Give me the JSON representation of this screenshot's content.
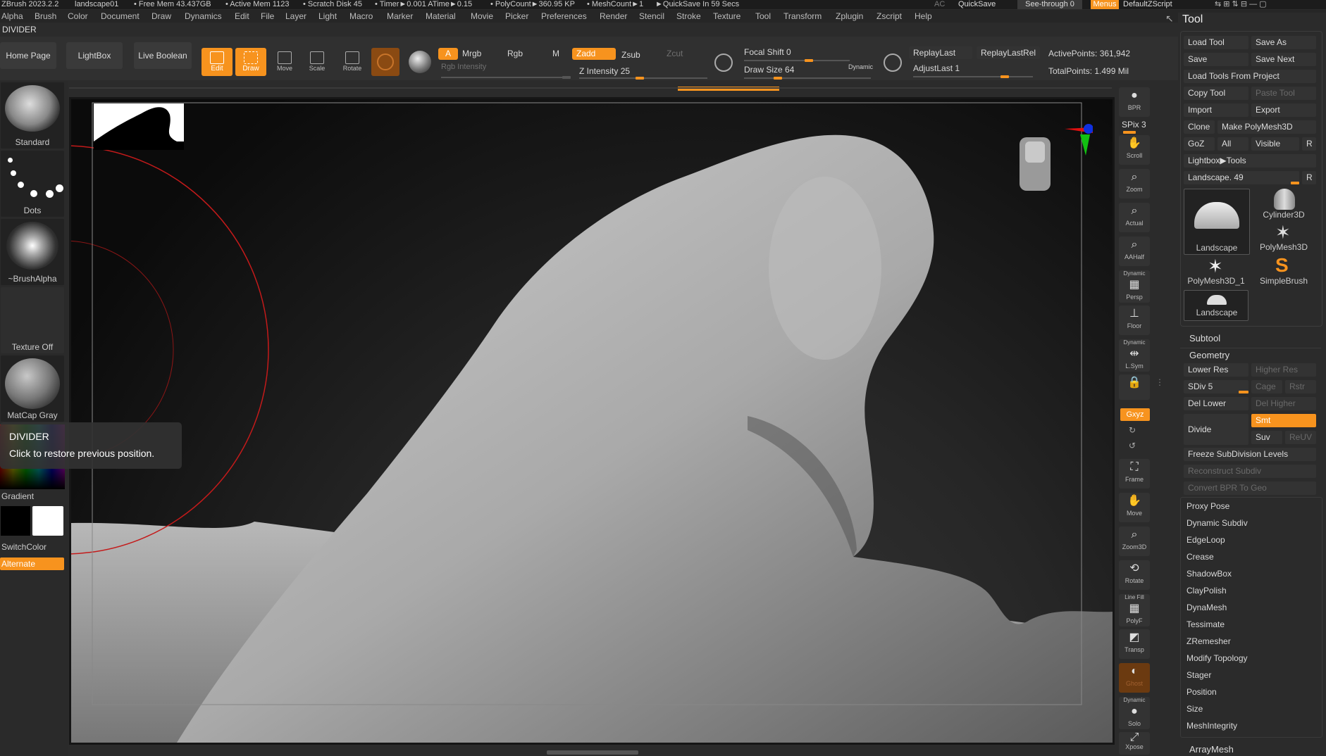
{
  "titlebar": {
    "app": "ZBrush 2023.2.2",
    "document": "landscape01",
    "free_mem": "• Free Mem 43.437GB",
    "active_mem": "• Active Mem 1123",
    "scratch": "• Scratch Disk 45",
    "timer": "• Timer►0.001 ATime►0.15",
    "polycount": "• PolyCount►360.95 KP",
    "meshcount": "• MeshCount►1",
    "quicksave_note": "►QuickSave In 59 Secs",
    "ac": "AC",
    "quicksave": "QuickSave",
    "seethrough": "See-through  0",
    "menus": "Menus",
    "script": "DefaultZScript"
  },
  "menubar": [
    "Alpha",
    "Brush",
    "Color",
    "Document",
    "Draw",
    "Dynamics",
    "Edit",
    "File",
    "Layer",
    "Light",
    "Macro",
    "Marker",
    "Material",
    "Movie",
    "Picker",
    "Preferences",
    "Render",
    "Stencil",
    "Stroke",
    "Texture",
    "Tool",
    "Transform",
    "Zplugin",
    "Zscript",
    "Help"
  ],
  "divider_label": "DIVIDER",
  "shelf": {
    "home": "Home Page",
    "lightbox": "LightBox",
    "liveboolean": "Live Boolean",
    "edit": "Edit",
    "draw": "Draw",
    "move": "Move",
    "scale": "Scale",
    "rotate": "Rotate",
    "a": "A",
    "mrgb": "Mrgb",
    "rgb": "Rgb",
    "m": "M",
    "zadd": "Zadd",
    "zsub": "Zsub",
    "zcut": "Zcut",
    "rgb_intensity": "Rgb Intensity",
    "z_intensity": "Z Intensity 25",
    "focal_shift": "Focal Shift 0",
    "draw_size": "Draw Size 64",
    "dynamic": "Dynamic",
    "replaylast": "ReplayLast",
    "replaylastrel": "ReplayLastRel",
    "adjustlast": "AdjustLast 1",
    "activepoints": "ActivePoints: 361,942",
    "totalpoints": "TotalPoints: 1.499 Mil"
  },
  "leftshelf": {
    "brush": "Standard",
    "stroke": "Dots",
    "alpha": "~BrushAlpha",
    "texture": "Texture Off",
    "material": "MatCap Gray",
    "gradient": "Gradient",
    "switchcolor": "SwitchColor",
    "alternate": "Alternate"
  },
  "tooltip": {
    "title": "DIVIDER",
    "text": "Click to restore previous position."
  },
  "rstrip": {
    "bpr": "BPR",
    "spix": "SPix 3",
    "scroll": "Scroll",
    "zoom": "Zoom",
    "actual": "Actual",
    "aahalf": "AAHalf",
    "dynamic1": "Dynamic",
    "persp": "Persp",
    "floor": "Floor",
    "dynamic2": "Dynamic",
    "lsym": "L.Sym",
    "xyz": "Gxyz",
    "frame": "Frame",
    "move": "Move",
    "zoom3d": "Zoom3D",
    "rotate": "Rotate",
    "linefill": "Line Fill",
    "polyf": "PolyF",
    "transp": "Transp",
    "ghost": "Ghost",
    "dynamic3": "Dynamic",
    "solo": "Solo",
    "xpose": "Xpose"
  },
  "toolpanel": {
    "title": "Tool",
    "load_tool": "Load Tool",
    "save_as": "Save As",
    "save": "Save",
    "save_next": "Save Next",
    "load_from_project": "Load Tools From Project",
    "copy_tool": "Copy Tool",
    "paste_tool": "Paste Tool",
    "import": "Import",
    "export": "Export",
    "clone": "Clone",
    "make_polymesh": "Make PolyMesh3D",
    "goz": "GoZ",
    "all": "All",
    "visible": "Visible",
    "r": "R",
    "lightbox_tools": "Lightbox▶Tools",
    "landscape_slider": "Landscape. 49",
    "tools": [
      "Landscape",
      "Cylinder3D",
      "PolyMesh3D",
      "PolyMesh3D_1",
      "SimpleBrush",
      "Landscape"
    ],
    "subtool": "Subtool",
    "geometry": "Geometry",
    "lower_res": "Lower Res",
    "higher_res": "Higher Res",
    "sdiv": "SDiv 5",
    "cage": "Cage",
    "rstr": "Rstr",
    "del_lower": "Del Lower",
    "del_higher": "Del Higher",
    "divide": "Divide",
    "smt": "Smt",
    "suv": "Suv",
    "reuv": "ReUV",
    "freeze": "Freeze SubDivision Levels",
    "reconstruct": "Reconstruct Subdiv",
    "convert_bpr": "Convert BPR To Geo",
    "menu_items": [
      "Proxy Pose",
      "Dynamic Subdiv",
      "EdgeLoop",
      "Crease",
      "ShadowBox",
      "ClayPolish",
      "DynaMesh",
      "Tessimate",
      "ZRemesher",
      "Modify Topology",
      "Stager",
      "Position",
      "Size",
      "MeshIntegrity"
    ],
    "arraymesh": "ArrayMesh"
  },
  "colors": {
    "accent": "#f7931e",
    "panel": "#2b2b2b",
    "button": "#333333"
  }
}
